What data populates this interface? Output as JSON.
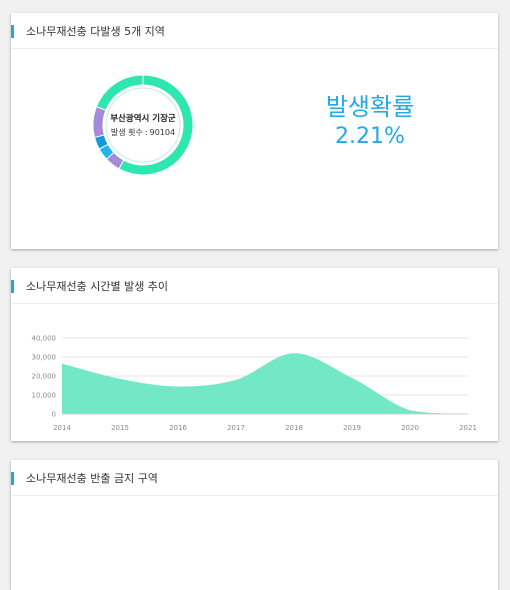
{
  "cards": {
    "top_regions": {
      "title": "소나무재선충 다발생 5개 지역"
    },
    "time_trend": {
      "title": "소나무재선충 시간별 발생 추이"
    },
    "ban_zone": {
      "title": "소나무재선충 반출 금지 구역"
    }
  },
  "donut": {
    "center_name": "부산광역시 기장군",
    "count_label": "발생 횟수",
    "count_separator": ":",
    "count_value": "90104"
  },
  "probability": {
    "label": "발생확률",
    "value": "2.21%"
  },
  "colors": {
    "accent": "#1aa9e8",
    "mint": "#2ee6b0",
    "area_fill": "#73e8c7"
  },
  "chart_data": [
    {
      "type": "pie",
      "donut": true,
      "slices": [
        {
          "value": 58,
          "color": "#2ee6b0"
        },
        {
          "value": 5,
          "color": "#a48ad8"
        },
        {
          "value": 4,
          "color": "#22b5ea"
        },
        {
          "value": 4,
          "color": "#1199e0"
        },
        {
          "value": 10,
          "color": "#a48ad8"
        },
        {
          "value": 19,
          "color": "#2ee6b0"
        }
      ]
    },
    {
      "type": "area",
      "x": [
        "2014",
        "2015",
        "2016",
        "2017",
        "2018",
        "2019",
        "2020",
        "2021"
      ],
      "values": [
        26500,
        18500,
        14500,
        18000,
        32000,
        19000,
        2000,
        0
      ],
      "ylim": [
        0,
        40000
      ],
      "yticks": [
        "0",
        "10,000",
        "20,000",
        "30,000",
        "40,000"
      ],
      "ytick_values": [
        0,
        10000,
        20000,
        30000,
        40000
      ],
      "grid": true
    }
  ]
}
